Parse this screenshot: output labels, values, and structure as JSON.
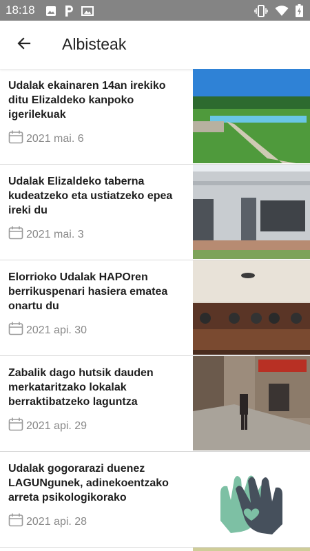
{
  "status_bar": {
    "time": "18:18",
    "left_icons": [
      "image-icon",
      "parking-p-icon",
      "photo-icon"
    ],
    "right_icons": [
      "vibrate-icon",
      "wifi-icon",
      "battery-charging-icon"
    ]
  },
  "app_bar": {
    "title": "Albisteak",
    "back_icon": "arrow-left-icon"
  },
  "news": [
    {
      "title": "Udalak ekainaren 14an irekiko ditu Elizaldeko kanpoko igerilekuak",
      "date": "2021 mai. 6",
      "image": "outdoor-swimming-pool"
    },
    {
      "title": "Udalak Elizaldeko taberna kudeatzeko eta ustiatzeko epea ireki du",
      "date": "2021 mai. 3",
      "image": "bar-building-exterior"
    },
    {
      "title": "Elorrioko Udalak HAPOren berrikuspenari hasiera ematea onartu du",
      "date": "2021 api. 30",
      "image": "council-meeting-room"
    },
    {
      "title": "Zabalik dago hutsik dauden merkataritzako lokalak berraktibatzeko laguntza",
      "date": "2021 api. 29",
      "image": "town-street"
    },
    {
      "title": "Udalak gogorarazi duenez LAGUNgunek, adinekoentzako arreta psikologikorako",
      "date": "2021 api. 28",
      "image": "hands-heart-logo"
    }
  ],
  "colors": {
    "status_bar": "#848484",
    "text": "#1e1e1e",
    "date": "#888888",
    "divider": "#d9d9d9"
  }
}
